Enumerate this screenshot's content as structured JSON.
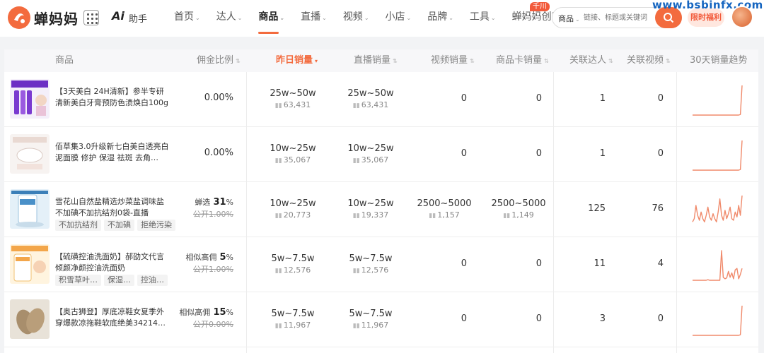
{
  "brand": {
    "name": "蝉妈妈",
    "ai": "Ai",
    "ai_label": "助手"
  },
  "nav": [
    {
      "label": "首页",
      "caret": true,
      "active": false
    },
    {
      "label": "达人",
      "caret": true,
      "active": false
    },
    {
      "label": "商品",
      "caret": true,
      "active": true
    },
    {
      "label": "直播",
      "caret": true,
      "active": false
    },
    {
      "label": "视频",
      "caret": true,
      "active": false
    },
    {
      "label": "小店",
      "caret": true,
      "active": false
    },
    {
      "label": "品牌",
      "caret": true,
      "active": false
    },
    {
      "label": "工具",
      "caret": true,
      "active": false
    },
    {
      "label": "蝉妈妈创意",
      "caret": false,
      "active": false
    }
  ],
  "badge_qianchuan": "千川",
  "search": {
    "type": "商品",
    "placeholder": "链接、标题或关键词"
  },
  "promo": "限时福利",
  "watermark": "www.bsbinfx.com",
  "columns": {
    "product": "商品",
    "commission": "佣金比例",
    "yesterday": "昨日销量",
    "live": "直播销量",
    "video": "视频销量",
    "card": "商品卡销量",
    "influencers": "关联达人",
    "videos": "关联视频",
    "trend": "30天销量趋势"
  },
  "colors": {
    "accent": "#f36b3e",
    "trend_line": "#f08a6b"
  },
  "rows": [
    {
      "title": "【3天美白 24H清新】参半专研清新美白牙膏预防色渍焕白100g",
      "tags": [],
      "commission": {
        "prefix": "",
        "value": "0.00%",
        "original": ""
      },
      "yesterday": {
        "range": "25w~50w",
        "count": "63,431"
      },
      "live": {
        "range": "25w~50w",
        "count": "63,431"
      },
      "video": "0",
      "card": "0",
      "influencers": "1",
      "videos": "0",
      "trend": [
        0,
        0,
        0,
        0,
        0,
        0,
        0,
        0,
        0,
        0,
        0,
        0,
        0,
        0,
        0,
        0,
        0,
        0,
        0,
        0,
        0,
        0,
        0,
        0,
        0,
        0,
        0,
        0,
        2,
        100
      ]
    },
    {
      "title": "佰草集3.0升级新七白美白透亮白泥面膜 修护 保湿 祛斑 去角…",
      "tags": [],
      "commission": {
        "prefix": "",
        "value": "0.00%",
        "original": ""
      },
      "yesterday": {
        "range": "10w~25w",
        "count": "35,067"
      },
      "live": {
        "range": "10w~25w",
        "count": "35,067"
      },
      "video": "0",
      "card": "0",
      "influencers": "1",
      "videos": "0",
      "trend": [
        0,
        0,
        0,
        0,
        0,
        0,
        0,
        0,
        0,
        0,
        0,
        0,
        0,
        0,
        0,
        0,
        0,
        0,
        0,
        0,
        0,
        0,
        0,
        0,
        0,
        0,
        0,
        0,
        2,
        100
      ]
    },
    {
      "title": "雪花山自然盐精选炒菜盐调味盐不加碘不加抗结剂0袋-直播",
      "tags": [
        "不加抗结剂",
        "不加碘",
        "拒绝污染"
      ],
      "commission": {
        "prefix": "蝉选",
        "value": "31",
        "unit": "%",
        "original": "公开1.00%"
      },
      "yesterday": {
        "range": "10w~25w",
        "count": "20,773"
      },
      "live": {
        "range": "10w~25w",
        "count": "19,337"
      },
      "video": {
        "range": "2500~5000",
        "count": "1,157"
      },
      "card": {
        "range": "2500~5000",
        "count": "1,149"
      },
      "influencers": "125",
      "videos": "76",
      "trend": [
        10,
        20,
        60,
        30,
        15,
        40,
        20,
        10,
        30,
        55,
        25,
        15,
        35,
        20,
        10,
        40,
        80,
        30,
        15,
        45,
        20,
        35,
        55,
        20,
        15,
        40,
        25,
        60,
        30,
        90
      ]
    },
    {
      "title": "【硫磺控油洗面奶】郝劭文代言倾颜净颜控油洗面奶",
      "tags": [
        "积雪草叶…",
        "保湿…",
        "控油…"
      ],
      "commission": {
        "prefix": "相似高佣",
        "value": "5",
        "unit": "%",
        "original": "公开1.00%"
      },
      "yesterday": {
        "range": "5w~7.5w",
        "count": "12,576"
      },
      "live": {
        "range": "5w~7.5w",
        "count": "12,576"
      },
      "video": "0",
      "card": "0",
      "influencers": "11",
      "videos": "4",
      "trend": [
        0,
        0,
        0,
        0,
        0,
        0,
        0,
        0,
        0,
        2,
        0,
        0,
        0,
        0,
        0,
        0,
        0,
        100,
        10,
        5,
        8,
        30,
        10,
        25,
        5,
        35,
        40,
        5,
        20,
        40
      ]
    },
    {
      "title": "【奥古狮登】厚底凉鞋女夏季外穿爆款凉拖鞋软底绝美34214…",
      "tags": [],
      "commission": {
        "prefix": "相似高佣",
        "value": "15",
        "unit": "%",
        "original": "公开0.00%"
      },
      "yesterday": {
        "range": "5w~7.5w",
        "count": "11,967"
      },
      "live": {
        "range": "5w~7.5w",
        "count": "11,967"
      },
      "video": "0",
      "card": "0",
      "influencers": "3",
      "videos": "0",
      "trend": [
        0,
        0,
        0,
        0,
        0,
        0,
        0,
        0,
        0,
        0,
        0,
        0,
        0,
        0,
        0,
        0,
        0,
        0,
        0,
        0,
        0,
        0,
        0,
        0,
        0,
        0,
        0,
        0,
        2,
        100
      ]
    }
  ]
}
